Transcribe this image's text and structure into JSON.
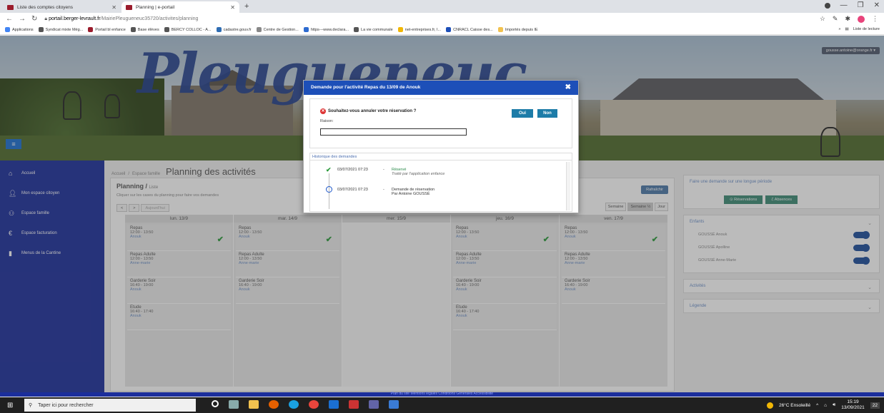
{
  "browser": {
    "tabs": [
      {
        "label": "Liste des comptes citoyens"
      },
      {
        "label": "Planning | e-portail"
      }
    ],
    "new_tab": "+",
    "url_host": "portail.berger-levrault.fr",
    "url_path": "/MairiePleugueneuc35720/activites/planning",
    "bookmarks": [
      "Applications",
      "Syndicat mixte Még...",
      "Portail bl enfance",
      "Base élèves",
      "BERCY COLLOC - A...",
      "cadastre.gouv.fr",
      "Centre de Gestion...",
      "https---www.declara...",
      "La vie communale",
      "net-entreprises.fr, I...",
      "CNRACL Caisse des...",
      "Importés depuis IE"
    ],
    "reading_list": "Liste de lecture",
    "more": "»"
  },
  "banner": {
    "logo": "Pleugueneuc",
    "user": "gousse.antoine@orange.fr ▾",
    "menu": "≡"
  },
  "sidebar": {
    "items": [
      {
        "icon": "home-icon",
        "label": "Accueil"
      },
      {
        "icon": "user-icon",
        "label": "Mon espace citoyen"
      },
      {
        "icon": "family-icon",
        "label": "Espace famille"
      },
      {
        "icon": "euro-icon",
        "label": "Espace facturation"
      },
      {
        "icon": "book-icon",
        "label": "Menus de la Cantine"
      }
    ]
  },
  "breadcrumb": {
    "home": "Accueil",
    "sep": "/",
    "section": "Espace famille",
    "title": "Planning des activités"
  },
  "planning": {
    "heading": "Planning",
    "view": "Liste",
    "hint": "Cliquer sur les cases du planning pour faire vos demandes",
    "prev": "<",
    "next": ">",
    "today": "Aujourd'hui",
    "refresh": "Rafraîchir",
    "views": [
      "Semaine",
      "Semaine ½",
      "Jour"
    ],
    "days": [
      "lun. 13/9",
      "mar. 14/9",
      "mer. 15/9",
      "jeu. 16/9",
      "ven. 17/9"
    ],
    "columns": [
      [
        {
          "name": "Repas",
          "time": "12:00 - 13:50",
          "child": "Anouk",
          "check": "✔"
        },
        {
          "name": "Repas Adulte",
          "time": "12:00 - 13:50",
          "child": "Anne-marie",
          "check": ""
        },
        {
          "name": "Garderie Soir",
          "time": "16:40 - 19:00",
          "child": "Anouk",
          "check": ""
        },
        {
          "name": "Etude",
          "time": "16:40 - 17:40",
          "child": "Anouk",
          "check": ""
        }
      ],
      [
        {
          "name": "Repas",
          "time": "12:00 - 13:50",
          "child": "Anouk",
          "check": "✔"
        },
        {
          "name": "Repas Adulte",
          "time": "12:00 - 13:50",
          "child": "Anne-marie",
          "check": ""
        },
        {
          "name": "Garderie Soir",
          "time": "16:40 - 19:00",
          "child": "Anouk",
          "check": ""
        }
      ],
      [],
      [
        {
          "name": "Repas",
          "time": "12:00 - 13:50",
          "child": "Anouk",
          "check": "✔"
        },
        {
          "name": "Repas Adulte",
          "time": "12:00 - 13:50",
          "child": "Anne-marie",
          "check": ""
        },
        {
          "name": "Garderie Soir",
          "time": "16:40 - 19:00",
          "child": "Anouk",
          "check": ""
        },
        {
          "name": "Etude",
          "time": "16:40 - 17:40",
          "child": "Anouk",
          "check": ""
        }
      ],
      [
        {
          "name": "Repas",
          "time": "12:00 - 13:50",
          "child": "Anouk",
          "check": "✔"
        },
        {
          "name": "Repas Adulte",
          "time": "12:00 - 13:50",
          "child": "Anne-marie",
          "check": ""
        },
        {
          "name": "Garderie Soir",
          "time": "16:40 - 19:00",
          "child": "Anouk",
          "check": ""
        }
      ]
    ]
  },
  "right": {
    "long_period": "Faire une demande sur une longue période",
    "reservations": "⊙ Réservations",
    "absences": "ℰ Absences",
    "children_title": "Enfants",
    "children": [
      "GOUSSÉ Anouk",
      "GOUSSÉ Apolline",
      "GOUSSÉ Anne-Marie"
    ],
    "activities": "Activités",
    "legend": "Légende",
    "chevron": "⌄"
  },
  "footer": "Plan du site   Mentions légales   Conditions Générales   Accessibilité",
  "modal": {
    "title": "Demande pour l'activité Repas du 13/09 de Anouk",
    "close": "✖",
    "question": "Souhaitez-vous annuler votre réservation ?",
    "reason_label": "Raison:",
    "reason_value": "",
    "yes": "Oui",
    "no": "Non",
    "history_title": "Historique des demandes",
    "history": [
      {
        "date": "03/07/2021 07:23",
        "sep": "-",
        "status": "Réservé",
        "sub": "Traité par l'application enfance"
      },
      {
        "date": "03/07/2021 07:23",
        "sep": "-",
        "status": "Demande de réservation",
        "sub": "Par Antoine GOUSSÉ"
      }
    ]
  },
  "taskbar": {
    "search_placeholder": "Taper ici pour rechercher",
    "weather": "26°C Ensoleillé",
    "time": "15:19",
    "date": "13/09/2021",
    "notif": "22"
  },
  "colors": {
    "sidebar": "#1b2e9c",
    "modal_header": "#1d4fb8",
    "button": "#1d7ca8",
    "check": "#2a9a3a"
  }
}
